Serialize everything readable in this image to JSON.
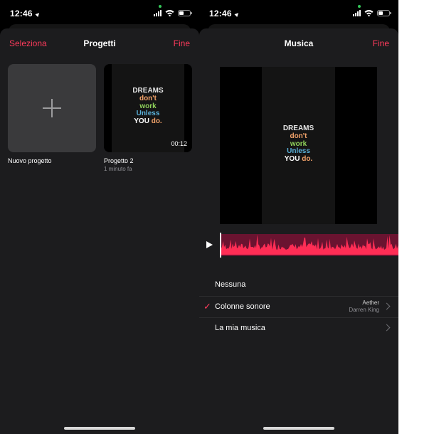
{
  "status_bar": {
    "time": "12:46"
  },
  "left": {
    "nav": {
      "left_label": "Seleziona",
      "title": "Progetti",
      "right_label": "Fine"
    },
    "new_project": {
      "label": "Nuovo progetto",
      "icon": "plus-icon"
    },
    "project": {
      "name": "Progetto 2",
      "modified": "1 minuto fa",
      "duration": "00:12"
    }
  },
  "quote": {
    "line1": "DREAMS",
    "line2": "don't",
    "line3": "work",
    "line4": "Unless",
    "line5a": "YOU",
    "line5b": "do."
  },
  "right": {
    "nav": {
      "title": "Musica",
      "right_label": "Fine"
    },
    "timeline": {
      "play_icon": "play-icon",
      "wave_color": "#ff2d55",
      "wave_bg": "#6a1330"
    },
    "music_list": {
      "none": "Nessuna",
      "soundtracks": {
        "label": "Colonne sonore",
        "track_title": "Aether",
        "track_artist": "Darren King",
        "selected": true
      },
      "my_music": "La mia musica"
    }
  },
  "colors": {
    "accent": "#ff3b5c",
    "sheet_bg": "#1c1c1e",
    "tile_bg": "#3a3a3c"
  }
}
